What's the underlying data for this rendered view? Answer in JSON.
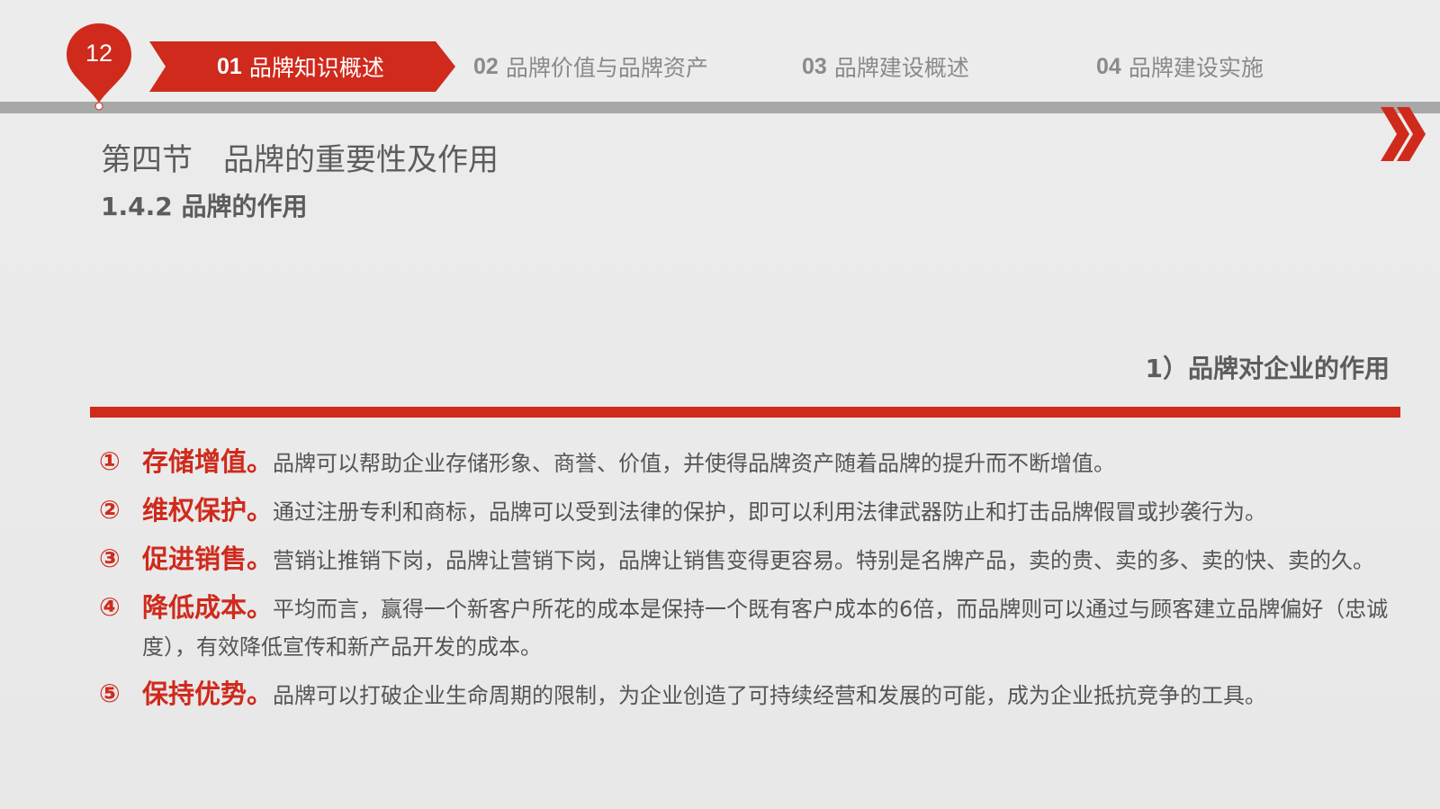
{
  "page": {
    "number": "12"
  },
  "nav": {
    "tabs": [
      {
        "num": "01",
        "label": "品牌知识概述",
        "active": true
      },
      {
        "num": "02",
        "label": "品牌价值与品牌资产",
        "active": false
      },
      {
        "num": "03",
        "label": "品牌建设概述",
        "active": false
      },
      {
        "num": "04",
        "label": "品牌建设实施",
        "active": false
      }
    ]
  },
  "section": {
    "title": "第四节　品牌的重要性及作用",
    "subtitle": "1.4.2 品牌的作用"
  },
  "point": {
    "heading": "1）品牌对企业的作用",
    "items": [
      {
        "marker": "①",
        "label": "存储增值。",
        "text": "品牌可以帮助企业存储形象、商誉、价值，并使得品牌资产随着品牌的提升而不断增值。"
      },
      {
        "marker": "②",
        "label": "维权保护。",
        "text": "通过注册专利和商标，品牌可以受到法律的保护，即可以利用法律武器防止和打击品牌假冒或抄袭行为。"
      },
      {
        "marker": "③",
        "label": "促进销售。",
        "text": "营销让推销下岗，品牌让营销下岗，品牌让销售变得更容易。特别是名牌产品，卖的贵、卖的多、卖的快、卖的久。"
      },
      {
        "marker": "④",
        "label": "降低成本。",
        "text": "平均而言，赢得一个新客户所花的成本是保持一个既有客户成本的6倍，而品牌则可以通过与顾客建立品牌偏好（忠诚度），有效降低宣传和新产品开发的成本。"
      },
      {
        "marker": "⑤",
        "label": "保持优势。",
        "text": "品牌可以打破企业生命周期的限制，为企业创造了可持续经营和发展的可能，成为企业抵抗竞争的工具。"
      }
    ]
  },
  "colors": {
    "accent": "#cf2a1c",
    "rule_gray": "#a8a8a8",
    "text": "#5c5c5c",
    "background": "#ebebeb"
  }
}
